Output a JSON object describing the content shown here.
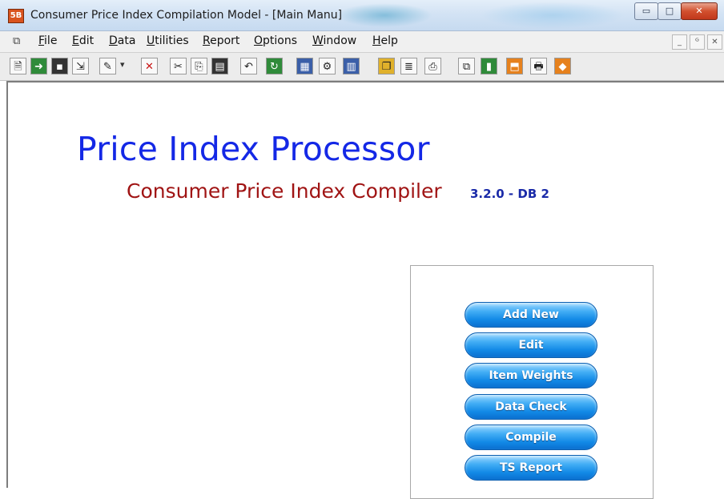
{
  "window": {
    "app_icon_text": "5B",
    "title": "Consumer Price Index Compilation Model - [Main Manu]",
    "controls": {
      "minimize": "▭",
      "maximize": "□",
      "close": "✕"
    }
  },
  "menubar": {
    "items": [
      "File",
      "Edit",
      "Data",
      "Utilities",
      "Report",
      "Options",
      "Window",
      "Help"
    ],
    "mdi_controls": {
      "minimize": "_",
      "restore": "ᴳ",
      "close": "✕"
    }
  },
  "toolbar": {
    "icons": [
      "new-document",
      "exit-door",
      "save",
      "open-file",
      "edit-pad",
      "dropdown-arrow",
      "delete-x",
      "cut",
      "copy",
      "paste",
      "undo",
      "refresh",
      "form-view",
      "settings",
      "grid-view",
      "lookup-book",
      "report",
      "print-preview",
      "window",
      "calculator",
      "export-red",
      "print",
      "help-book"
    ]
  },
  "main": {
    "app_title": "Price Index Processor",
    "app_subtitle": "Consumer Price Index Compiler",
    "version": "3.2.0 - DB 2",
    "colors": {
      "title": "#1428e6",
      "subtitle": "#a01414",
      "version": "#1a2aa8",
      "button": "#1a8ff0"
    },
    "buttons": [
      "Add New",
      "Edit",
      "Item Weights",
      "Data Check",
      "Compile",
      "TS Report"
    ]
  }
}
